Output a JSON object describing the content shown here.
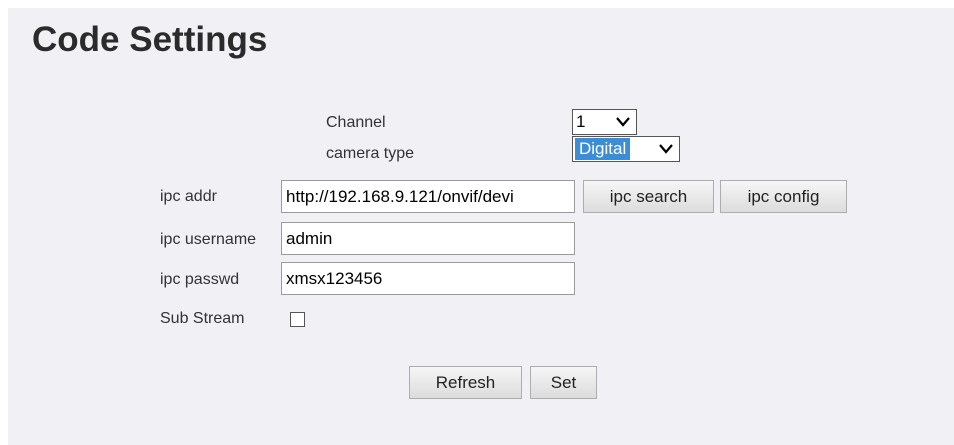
{
  "page": {
    "title": "Code Settings"
  },
  "form": {
    "channel": {
      "label": "Channel",
      "value": "1"
    },
    "camera_type": {
      "label": "camera type",
      "value": "Digital"
    },
    "ipc_addr": {
      "label": "ipc addr",
      "value": "http://192.168.9.121/onvif/devi"
    },
    "ipc_username": {
      "label": "ipc username",
      "value": "admin"
    },
    "ipc_passwd": {
      "label": "ipc passwd",
      "value": "xmsx123456"
    },
    "sub_stream": {
      "label": "Sub Stream",
      "checked": false
    }
  },
  "buttons": {
    "ipc_search": "ipc search",
    "ipc_config": "ipc config",
    "refresh": "Refresh",
    "set": "Set"
  },
  "icons": {
    "select_arrow": "chevron-down-icon"
  },
  "colors": {
    "panel_bg": "#f0f0f5",
    "selected_highlight": "#3b8ed6"
  }
}
